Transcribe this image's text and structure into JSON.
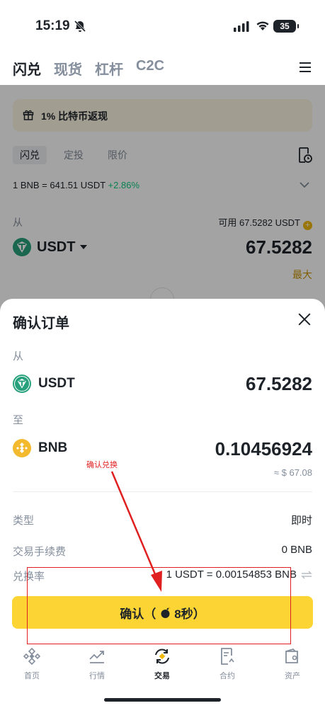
{
  "status_bar": {
    "time": "15:19",
    "battery": "35"
  },
  "top_nav": {
    "tabs": [
      "闪兑",
      "现货",
      "杠杆",
      "C2C"
    ]
  },
  "background": {
    "cashback": "1% 比特币返现",
    "subtabs": [
      "闪兑",
      "定投",
      "限价"
    ],
    "rate": "1 BNB = 641.51 USDT",
    "rate_change": "+2.86%",
    "from_label": "从",
    "available": "可用 67.5282 USDT",
    "asset": "USDT",
    "amount": "67.5282",
    "max": "最大"
  },
  "sheet": {
    "title": "确认订单",
    "from_label": "从",
    "from_asset": "USDT",
    "from_amount": "67.5282",
    "to_label": "至",
    "to_asset": "BNB",
    "to_amount": "0.10456924",
    "to_approx": "≈ $ 67.08",
    "type_label": "类型",
    "type_value": "即时",
    "fee_label": "交易手续费",
    "fee_value": "0 BNB",
    "rate_label": "兑换率",
    "rate_value": "1 USDT = 0.00154853 BNB",
    "confirm_text": "确认（",
    "confirm_countdown": "8秒）"
  },
  "annotation": {
    "label": "确认兑换",
    "color": "#e02020"
  },
  "bottom_nav": {
    "items": [
      "首页",
      "行情",
      "交易",
      "合约",
      "资产"
    ],
    "active": "交易"
  },
  "colors": {
    "brand_yellow": "#fcd535",
    "up_green": "#0ecb81",
    "muted": "#848e9c",
    "usdt_teal": "#26a17b",
    "bnb_gold": "#f3ba2f"
  }
}
